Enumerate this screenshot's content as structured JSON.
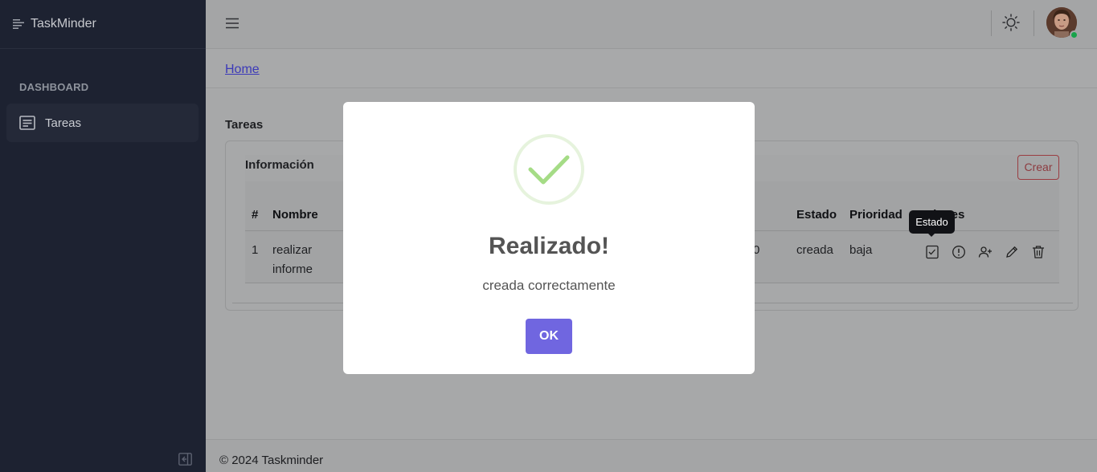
{
  "app": {
    "brand": "TaskMinder"
  },
  "sidebar": {
    "section_label": "DASHBOARD",
    "items": [
      {
        "label": "Tareas",
        "icon": "list-icon"
      }
    ]
  },
  "breadcrumb": {
    "home": "Home"
  },
  "main": {
    "title": "Tareas",
    "card": {
      "title": "Información",
      "create_button": "Crear",
      "columns": [
        "#",
        "Nombre",
        "Estado",
        "Prioridad",
        "Opciones"
      ],
      "rows": [
        {
          "num": "1",
          "name": "realizar informe",
          "partial": "0",
          "estado": "creada",
          "prioridad": "baja"
        }
      ],
      "actions": [
        "status-icon",
        "info-icon",
        "add-user-icon",
        "edit-icon",
        "delete-icon"
      ]
    },
    "tooltip": "Estado"
  },
  "footer": {
    "text": "© 2024 Taskminder"
  },
  "modal": {
    "title": "Realizado!",
    "text": "creada correctamente",
    "ok": "OK",
    "icon": "success-check-icon"
  },
  "colors": {
    "sidebar_bg": "#1d2231",
    "ok_button": "#7066e0",
    "success": "#a5dc86",
    "danger": "#dc3545",
    "online": "#17a34a"
  }
}
